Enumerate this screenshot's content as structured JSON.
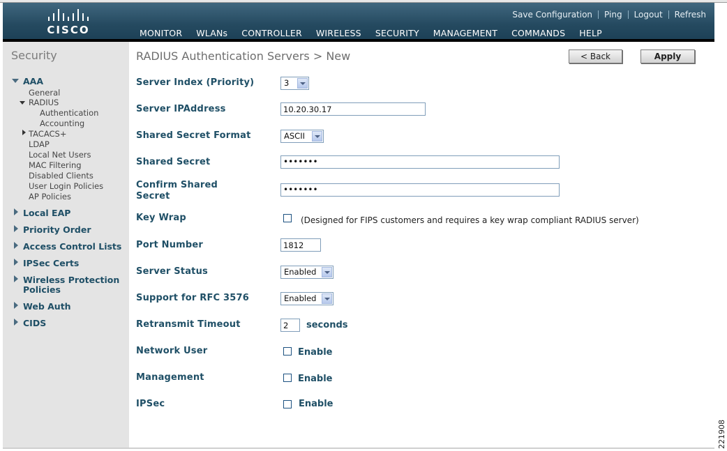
{
  "brand": {
    "name": "CISCO"
  },
  "utility_links": [
    "Save Configuration",
    "Ping",
    "Logout",
    "Refresh"
  ],
  "nav": [
    {
      "label": "MONITOR",
      "active": false
    },
    {
      "label": "WLANs",
      "active": false
    },
    {
      "label": "CONTROLLER",
      "active": false
    },
    {
      "label": "WIRELESS",
      "active": false
    },
    {
      "label": "SECURITY",
      "active": true
    },
    {
      "label": "MANAGEMENT",
      "active": false
    },
    {
      "label": "COMMANDS",
      "active": false
    },
    {
      "label": "HELP",
      "active": false
    }
  ],
  "sidebar": {
    "title": "Security",
    "aaa": {
      "label": "AAA",
      "general": "General",
      "radius": "RADIUS",
      "authentication": "Authentication",
      "accounting": "Accounting",
      "tacacs": "TACACS+",
      "ldap": "LDAP",
      "local_net_users": "Local Net Users",
      "mac_filtering": "MAC Filtering",
      "disabled_clients": "Disabled Clients",
      "user_login_policies": "User Login Policies",
      "ap_policies": "AP Policies"
    },
    "sections": {
      "local_eap": "Local EAP",
      "priority_order": "Priority Order",
      "acl": "Access Control Lists",
      "ipsec_certs": "IPSec Certs",
      "wpp_line1": "Wireless Protection",
      "wpp_line2": "Policies",
      "web_auth": "Web Auth",
      "cids": "CIDS"
    }
  },
  "page": {
    "title": "RADIUS Authentication Servers > New",
    "back_label": "< Back",
    "apply_label": "Apply"
  },
  "form": {
    "server_index_label": "Server Index (Priority)",
    "server_index_value": "3",
    "server_ip_label": "Server IPAddress",
    "server_ip_value": "10.20.30.17",
    "secret_format_label": "Shared Secret Format",
    "secret_format_value": "ASCII",
    "shared_secret_label": "Shared Secret",
    "shared_secret_value": "•••••••",
    "confirm_secret_label_line1": "Confirm Shared",
    "confirm_secret_label_line2": "Secret",
    "confirm_secret_value": "•••••••",
    "key_wrap_label": "Key Wrap",
    "key_wrap_note": "(Designed for FIPS customers and requires a key wrap compliant RADIUS server)",
    "port_label": "Port Number",
    "port_value": "1812",
    "server_status_label": "Server Status",
    "server_status_value": "Enabled",
    "rfc_label": "Support for RFC 3576",
    "rfc_value": "Enabled",
    "retransmit_label": "Retransmit Timeout",
    "retransmit_value": "2",
    "retransmit_unit": "seconds",
    "network_user_label": "Network User",
    "network_user_enable": "Enable",
    "management_label": "Management",
    "management_enable": "Enable",
    "ipsec_label": "IPSec",
    "ipsec_enable": "Enable"
  },
  "figure_code": "221908"
}
